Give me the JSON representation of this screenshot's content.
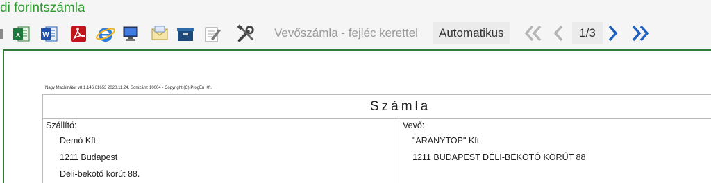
{
  "window": {
    "title": "di forintszámla"
  },
  "toolbar": {
    "icons": [
      "excel-icon",
      "word-icon",
      "pdf-icon",
      "internet-explorer-icon",
      "computer-icon",
      "email-icon",
      "archive-box-icon",
      "edit-icon",
      "tools-icon"
    ],
    "layout_label": "Vevőszámla - fejléc kerettel",
    "mode_button": "Automatikus",
    "page_indicator": "1/3"
  },
  "invoice": {
    "meta_line": "Nagy Machinátor v8.1.146.61653 2020.11.24. Sorszám: 10004 - Copyright (C) ProgEn Kft.",
    "title": "Számla",
    "supplier": {
      "label": "Szállító:",
      "name": "Demó Kft",
      "city": "1211 Budapest",
      "street": "Déli-bekötő körút 88."
    },
    "buyer": {
      "label": "Vevő:",
      "name": "\"ARANYTOP\" Kft",
      "address": "1211 BUDAPEST DÉLI-BEKÖTŐ KÖRÚT 88"
    }
  },
  "colors": {
    "title_green": "#2e9a2e",
    "accent_blue": "#1f5fbf",
    "frame_green": "#2e7d32"
  }
}
